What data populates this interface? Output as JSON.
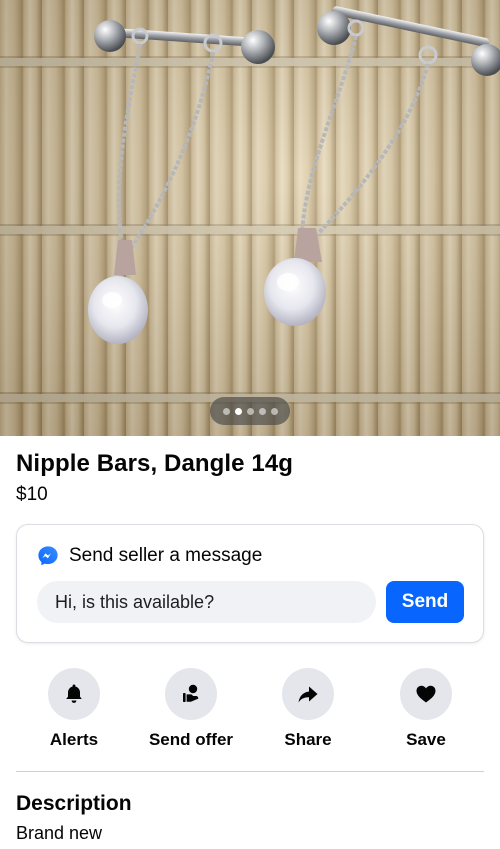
{
  "listing": {
    "title": "Nipple Bars, Dangle 14g",
    "price": "$10",
    "photo": {
      "image_count": 5,
      "active_index": 1
    }
  },
  "message": {
    "header": "Send seller a message",
    "icon": "messenger-icon",
    "input_value": "Hi, is this available?",
    "send_label": "Send",
    "accent": "#0866ff"
  },
  "actions": [
    {
      "label": "Alerts",
      "icon": "bell-icon"
    },
    {
      "label": "Send offer",
      "icon": "offer-icon"
    },
    {
      "label": "Share",
      "icon": "share-icon"
    },
    {
      "label": "Save",
      "icon": "heart-icon"
    }
  ],
  "description": {
    "heading": "Description",
    "body": "Brand new"
  }
}
